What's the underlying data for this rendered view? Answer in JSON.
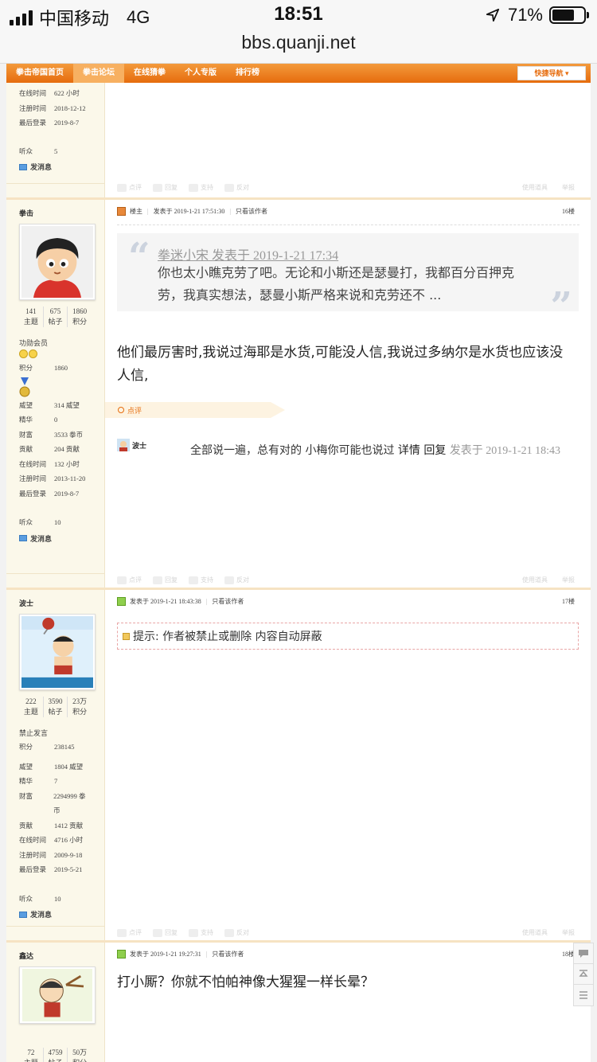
{
  "status_bar": {
    "carrier": "中国移动",
    "network": "4G",
    "time": "18:51",
    "battery": "71%",
    "battery_level": 0.71,
    "url": "bbs.quanji.net"
  },
  "nav": {
    "items": [
      "拳击帝国首页",
      "拳击论坛",
      "在线猜拳",
      "个人专版",
      "排行榜"
    ],
    "active": "拳击论坛",
    "quick_nav": "快捷导航"
  },
  "actions": {
    "rate": "点评",
    "reply": "回复",
    "support": "支持",
    "oppose": "反对",
    "tools": "使用道具",
    "report": "举报"
  },
  "post0": {
    "profile": [
      {
        "k": "在线时间",
        "v": "622 小时"
      },
      {
        "k": "注册时间",
        "v": "2018-12-12"
      },
      {
        "k": "最后登录",
        "v": "2019-8-7"
      }
    ],
    "listen_label": "听众",
    "listen": "5",
    "send_msg": "发消息"
  },
  "post1": {
    "username": "拳击",
    "stats": [
      {
        "value": "141",
        "label": "主题"
      },
      {
        "value": "675",
        "label": "帖子"
      },
      {
        "value": "1860",
        "label": "积分"
      }
    ],
    "group": "功勋会员",
    "points_label": "积分",
    "points": "1860",
    "profile": [
      {
        "k": "威望",
        "v": "314 威望"
      },
      {
        "k": "精华",
        "v": "0"
      },
      {
        "k": "财富",
        "v": "3533 拳币"
      },
      {
        "k": "贡献",
        "v": "204 贡献"
      },
      {
        "k": "在线时间",
        "v": "132 小时"
      },
      {
        "k": "注册时间",
        "v": "2013-11-20"
      },
      {
        "k": "最后登录",
        "v": "2019-8-7"
      }
    ],
    "listen_label": "听众",
    "listen": "10",
    "send_msg": "发消息",
    "owner_label": "楼主",
    "posted_at": "发表于 2019-1-21 17:51:30",
    "author_only": "只看该作者",
    "floor": "16楼",
    "quote_head": "拳迷小宋 发表于 2019-1-21 17:34",
    "quote_text": "你也太小瞧克劳了吧。无论和小斯还是瑟曼打，我都百分百押克劳，我真实想法，瑟曼小斯严格来说和克劳还不 ...",
    "body": "他们最厉害时,我说过海耶是水货,可能没人信,我说过多纳尔是水货也应该没人信,",
    "rate_label": "点评",
    "comment_user": "波士",
    "comment_text": "全部说一遍，总有对的 小梅你可能也说过 ",
    "comment_detail": "详情",
    "comment_reply": "回复",
    "comment_date": "发表于 2019-1-21 18:43"
  },
  "post2": {
    "username": "波士",
    "stats": [
      {
        "value": "222",
        "label": "主题"
      },
      {
        "value": "3590",
        "label": "帖子"
      },
      {
        "value": "23万",
        "label": "积分"
      }
    ],
    "group": "禁止发言",
    "points_label": "积分",
    "points": "238145",
    "profile": [
      {
        "k": "威望",
        "v": "1804 威望"
      },
      {
        "k": "精华",
        "v": "7"
      },
      {
        "k": "财富",
        "v": "2294999 拳币"
      },
      {
        "k": "贡献",
        "v": "1412 贡献"
      },
      {
        "k": "在线时间",
        "v": "4716 小时"
      },
      {
        "k": "注册时间",
        "v": "2009-9-18"
      },
      {
        "k": "最后登录",
        "v": "2019-5-21"
      }
    ],
    "listen_label": "听众",
    "listen": "10",
    "send_msg": "发消息",
    "posted_at": "发表于 2019-1-21 18:43:38",
    "author_only": "只看该作者",
    "floor": "17楼",
    "tip": "提示: 作者被禁止或删除 内容自动屏蔽"
  },
  "post3": {
    "username": "鑫达",
    "stats": [
      {
        "value": "72",
        "label": "主题"
      },
      {
        "value": "4759",
        "label": "帖子"
      },
      {
        "value": "50万",
        "label": "积分"
      }
    ],
    "posted_at": "发表于 2019-1-21 19:27:31",
    "author_only": "只看该作者",
    "floor": "18楼",
    "body": "打小厮？你就不怕帕神像大猩猩一样长晕？"
  }
}
